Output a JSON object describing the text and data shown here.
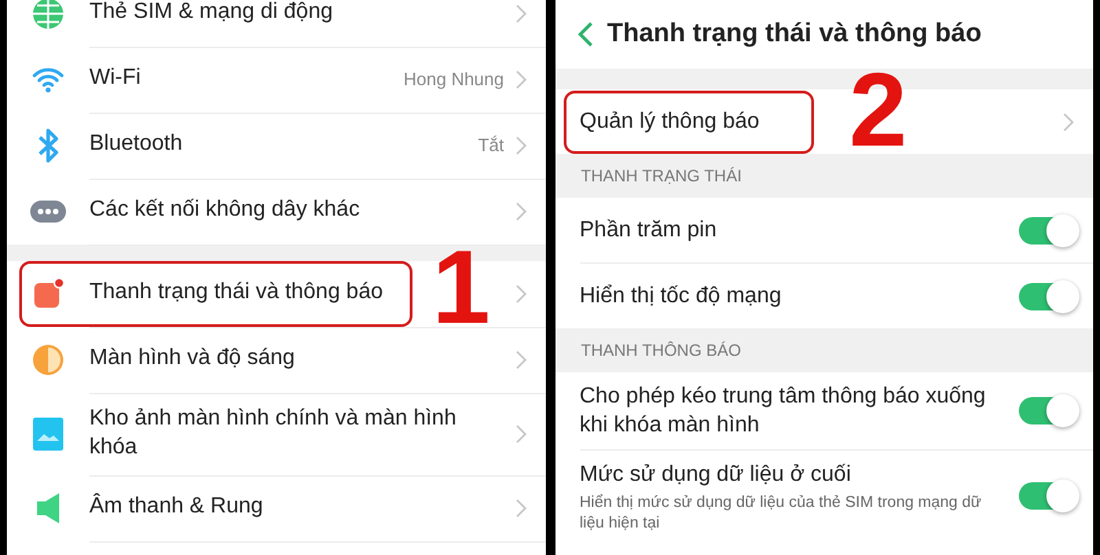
{
  "settings_list": {
    "groups": [
      {
        "items": [
          {
            "label": "Thẻ SIM & mạng di động"
          },
          {
            "label": "Wi-Fi",
            "value": "Hong Nhung"
          },
          {
            "label": "Bluetooth",
            "value": "Tắt"
          },
          {
            "label": "Các kết nối không dây khác"
          }
        ]
      },
      {
        "items": [
          {
            "label": "Thanh trạng thái và thông báo",
            "highlighted": true,
            "callout": "1"
          },
          {
            "label": "Màn hình và độ sáng"
          },
          {
            "label": "Kho ảnh màn hình chính và màn hình khóa"
          },
          {
            "label": "Âm thanh & Rung"
          }
        ]
      }
    ]
  },
  "notification_screen": {
    "title": "Thanh trạng thái và thông báo",
    "sections": [
      {
        "items": [
          {
            "kind": "link",
            "label": "Quản lý thông báo",
            "highlighted": true,
            "callout": "2"
          }
        ]
      },
      {
        "title": "THANH TRẠNG THÁI",
        "items": [
          {
            "kind": "toggle",
            "label": "Phần trăm pin",
            "on": true
          },
          {
            "kind": "toggle",
            "label": "Hiển thị tốc độ mạng",
            "on": true
          }
        ]
      },
      {
        "title": "THANH THÔNG BÁO",
        "items": [
          {
            "kind": "toggle",
            "label": "Cho phép kéo trung tâm thông báo xuống khi khóa màn hình",
            "on": true
          },
          {
            "kind": "toggle",
            "label": "Mức sử dụng dữ liệu ở cuối",
            "description": "Hiển thị mức sử dụng dữ liệu của thẻ SIM trong mạng dữ liệu hiện tại",
            "on": true
          }
        ]
      }
    ]
  }
}
